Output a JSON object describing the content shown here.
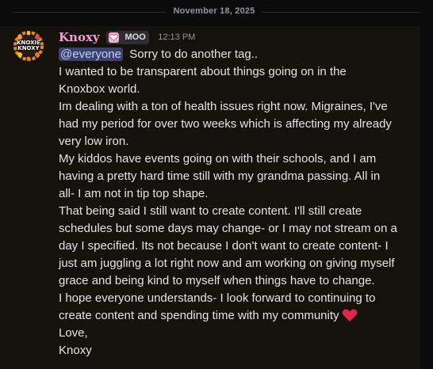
{
  "date_divider": "November 18, 2025",
  "message": {
    "avatar": {
      "text_line1": "KNOXIE",
      "text_line2": "KNOXY"
    },
    "username": "Knoxy",
    "role_tag": {
      "icon": "heart-tag-icon",
      "label": "MOO"
    },
    "timestamp": "12:13 PM",
    "mention": "@everyone",
    "lines": [
      "Sorry to do another tag..",
      "I wanted to be transparent about things going on in the",
      "Knoxbox world.",
      "Im dealing with a ton of health issues right now. Migraines, I've",
      "had my period for over two weeks which is affecting my already",
      "very low iron.",
      "My kiddos have events going on with their schools, and I am",
      "having a pretty hard time still with my grandma passing. All in",
      "all- I am not in tip top shape.",
      "That being said I still want to create content. I'll still create",
      "schedules but some days may change- or I may not stream on a",
      "day I specified. Its not because I don't want to create content- I",
      "just am juggling a lot right now and am working on giving myself",
      "grace and being kind to myself when things have to change.",
      "I hope everyone understands- I look forward to continuing to",
      "create content and spending time with my community",
      "Love,",
      "Knoxy"
    ],
    "heart_emoji": "red-heart-emoji"
  },
  "colors": {
    "background": "#0b0b0c",
    "message_background": "#15120c",
    "username": "#f79ad6",
    "mention_bg": "#3c4270",
    "mention_text": "#c9cdfb",
    "text": "#e4e4e6",
    "heart": "#e0264a"
  }
}
